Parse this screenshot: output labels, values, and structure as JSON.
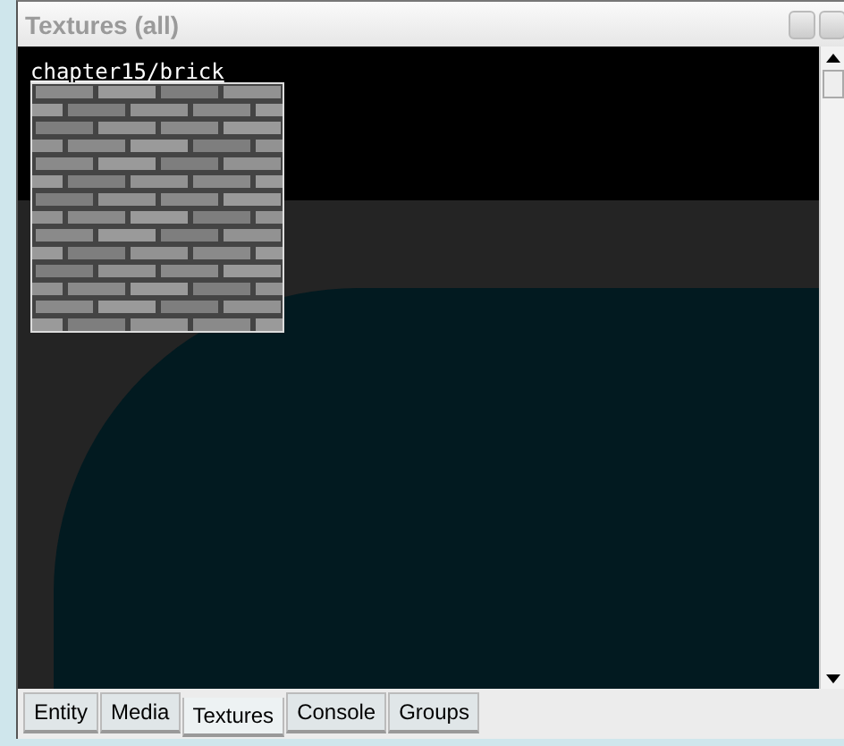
{
  "window": {
    "title": "Textures (all)"
  },
  "textures": [
    {
      "name": "chapter15/brick",
      "selected": true
    }
  ],
  "tabs": [
    {
      "label": "Entity",
      "selected": false
    },
    {
      "label": "Media",
      "selected": false
    },
    {
      "label": "Textures",
      "selected": true
    },
    {
      "label": "Console",
      "selected": false
    },
    {
      "label": "Groups",
      "selected": false
    }
  ]
}
